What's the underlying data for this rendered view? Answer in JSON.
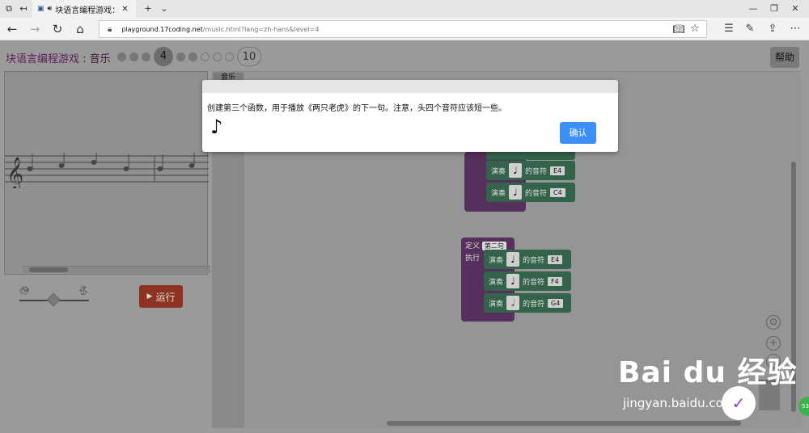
{
  "browser": {
    "tab_title": "块语言编程游戏：音",
    "url_host": "playground.17coding.net",
    "url_path": "/music.html?lang=zh-hans&level=4"
  },
  "app": {
    "title_main": "块语言编程游戏",
    "title_sep": " : ",
    "title_sub": "音乐",
    "current_level": "4",
    "last_level": "10",
    "help_label": "帮助",
    "run_label": "运行"
  },
  "toolbox": {
    "label": "音乐"
  },
  "blocks": {
    "play_label": "演奏",
    "note_suffix": "的音符",
    "define_label": "定义",
    "exec_label": "执行",
    "func_name": "第二句",
    "func1_pitches": [
      "E4",
      "C4"
    ],
    "func2_pitches": [
      "E4",
      "F4",
      "G4"
    ]
  },
  "dialog": {
    "message": "创建第三个函数，用于播放《两只老虎》的下一句。注意，头四个音符应该短一些。",
    "note_glyph": "♪",
    "ok_label": "确认"
  },
  "watermark": {
    "brand": "Bai du 经验",
    "url": "jingyan.baidu.com",
    "badge": "53"
  },
  "colors": {
    "run_button": "#8e3322",
    "ok_button": "#3c8ff7",
    "function_block": "#55305c",
    "play_block": "#33634a"
  }
}
